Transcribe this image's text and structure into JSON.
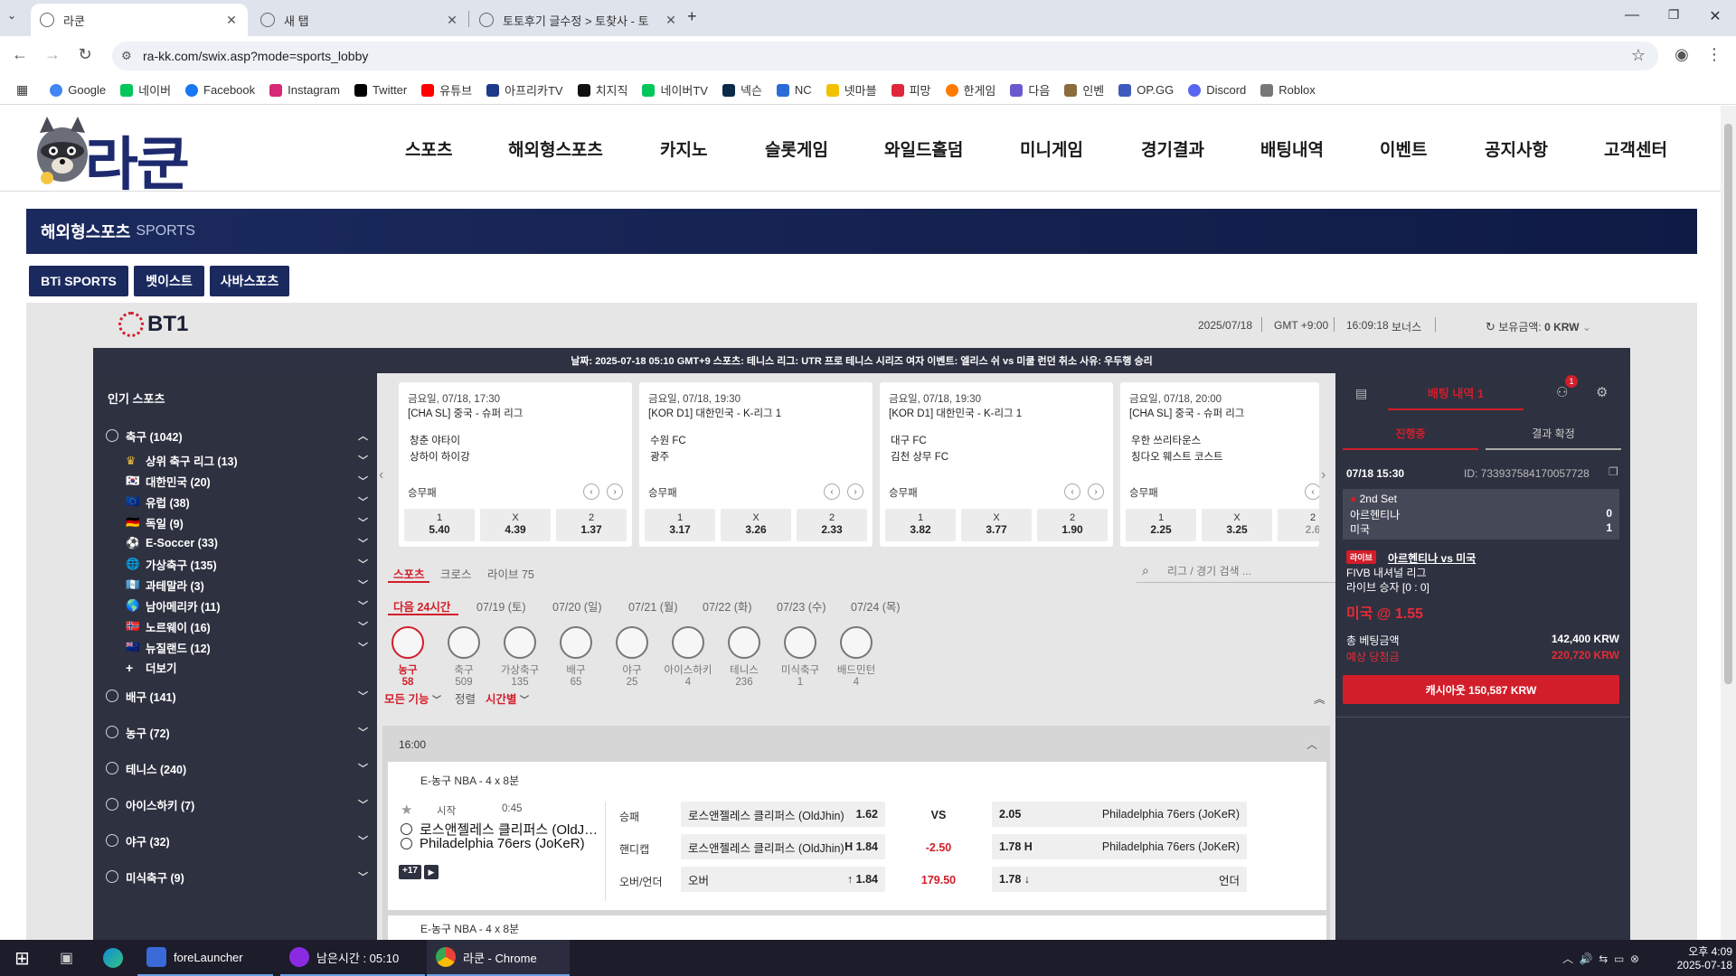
{
  "browser": {
    "tabs": [
      {
        "title": "라쿤",
        "active": true
      },
      {
        "title": "새 탭",
        "active": false
      },
      {
        "title": "토토후기 글수정 > 토찾사 - 토",
        "active": false
      }
    ],
    "url": "ra-kk.com/swix.asp?mode=sports_lobby",
    "bookmarks": [
      "Google",
      "네이버",
      "Facebook",
      "Instagram",
      "Twitter",
      "유튜브",
      "아프리카TV",
      "치지직",
      "네이버TV",
      "넥슨",
      "NC",
      "넷마블",
      "피망",
      "한게임",
      "다음",
      "인벤",
      "OP.GG",
      "Discord",
      "Roblox"
    ]
  },
  "site": {
    "logo_text": "라쿤",
    "nav": [
      "스포츠",
      "해외형스포츠",
      "카지노",
      "슬롯게임",
      "와일드홀덤",
      "미니게임",
      "경기결과",
      "배팅내역",
      "이벤트",
      "공지사항",
      "고객센터"
    ],
    "banner_title": "해외형스포츠",
    "banner_sub": "SPORTS",
    "providers": [
      "BTi SPORTS",
      "벳이스트",
      "사바스포츠"
    ]
  },
  "bti": {
    "logo": "BT1",
    "date": "2025/07/18",
    "gmt": "GMT +9:00",
    "time": "16:09:18",
    "bonus": "보너스",
    "balance_label": "보유금액:",
    "balance_value": "0 KRW",
    "ticker": "날짜: 2025-07-18 05:10 GMT+9 스포츠: 테니스 리그: UTR 프로 테니스 시리즈 여자 이벤트: 엘리스 쉬 vs 미쿨 런던 취소 사유: 우두행 승리"
  },
  "sidebar": {
    "title": "인기 스포츠",
    "soccer": "축구 (1042)",
    "soccer_sub": [
      "상위 축구 리그 (13)",
      "대한민국 (20)",
      "유럽 (38)",
      "독일 (9)",
      "E-Soccer (33)",
      "가상축구 (135)",
      "과테말라 (3)",
      "남아메리카 (11)",
      "노르웨이 (16)",
      "뉴질랜드 (12)"
    ],
    "more": "더보기",
    "sports": [
      "배구 (141)",
      "농구 (72)",
      "테니스 (240)",
      "아이스하키 (7)",
      "야구 (32)",
      "미식축구 (9)"
    ]
  },
  "cards": [
    {
      "date": "금요일, 07/18, 17:30",
      "league": "[CHA SL] 중국 - 슈퍼 리그",
      "home": "창춘 야타이",
      "away": "상하이 하이강",
      "market": "승무패",
      "odds": [
        {
          "l": "1",
          "v": "5.40"
        },
        {
          "l": "X",
          "v": "4.39"
        },
        {
          "l": "2",
          "v": "1.37"
        }
      ]
    },
    {
      "date": "금요일, 07/18, 19:30",
      "league": "[KOR D1] 대한민국 - K-리그 1",
      "home": "수원 FC",
      "away": "광주",
      "market": "승무패",
      "odds": [
        {
          "l": "1",
          "v": "3.17"
        },
        {
          "l": "X",
          "v": "3.26"
        },
        {
          "l": "2",
          "v": "2.33"
        }
      ]
    },
    {
      "date": "금요일, 07/18, 19:30",
      "league": "[KOR D1] 대한민국 - K-리그 1",
      "home": "대구 FC",
      "away": "김천 상무 FC",
      "market": "승무패",
      "odds": [
        {
          "l": "1",
          "v": "3.82"
        },
        {
          "l": "X",
          "v": "3.77"
        },
        {
          "l": "2",
          "v": "1.90"
        }
      ]
    },
    {
      "date": "금요일, 07/18, 20:00",
      "league": "[CHA SL] 중국 - 슈퍼 리그",
      "home": "우한 쓰리타운스",
      "away": "칭다오 웨스트 코스트",
      "market": "승무패",
      "odds": [
        {
          "l": "1",
          "v": "2.25"
        },
        {
          "l": "X",
          "v": "3.25"
        },
        {
          "l": "2",
          "v": "2.6"
        }
      ]
    }
  ],
  "center": {
    "tabs": [
      "스포츠",
      "크로스",
      "라이브 75"
    ],
    "search_placeholder": "리그 / 경기 검색 ...",
    "dates": [
      "다음 24시간",
      "07/19 (토)",
      "07/20 (일)",
      "07/21 (월)",
      "07/22 (화)",
      "07/23 (수)",
      "07/24 (목)"
    ],
    "sports": [
      {
        "name": "농구",
        "count": "58"
      },
      {
        "name": "축구",
        "count": "509"
      },
      {
        "name": "가상축구",
        "count": "135"
      },
      {
        "name": "배구",
        "count": "65"
      },
      {
        "name": "야구",
        "count": "25"
      },
      {
        "name": "아이스하키",
        "count": "4"
      },
      {
        "name": "테니스",
        "count": "236"
      },
      {
        "name": "미식축구",
        "count": "1"
      },
      {
        "name": "배드민턴",
        "count": "4"
      }
    ],
    "all_features": "모든 기능",
    "sort_label": "정렬",
    "sort_value": "시간별"
  },
  "event": {
    "time": "16:00",
    "league": "E-농구 NBA - 4 x 8분",
    "start_label": "시작",
    "start_time": "0:45",
    "home": "로스앤젤레스 클리퍼스 (OldJ…",
    "away": "Philadelphia 76ers (JoKeR)",
    "more": "+17",
    "markets": [
      {
        "label": "승패",
        "left": "로스앤젤레스 클리퍼스 (OldJhin)",
        "lv": "1.62",
        "mid": "VS",
        "rv": "2.05",
        "right": "Philadelphia 76ers (JoKeR)"
      },
      {
        "label": "핸디캡",
        "left": "로스앤젤레스 클리퍼스 (OldJhin)",
        "lv": "H 1.84",
        "mid": "-2.50",
        "rv": "1.78 H",
        "right": "Philadelphia 76ers (JoKeR)"
      },
      {
        "label": "오버/언더",
        "left": "오버",
        "lv": "↑ 1.84",
        "mid": "179.50",
        "rv": "1.78 ↓",
        "right": "언더"
      }
    ],
    "next_league": "E-농구 NBA - 4 x 8분"
  },
  "betslip": {
    "title": "배팅 내역 1",
    "badge": "1",
    "tabs": [
      "진행중",
      "결과 확정"
    ],
    "date": "07/18 15:30",
    "id": "ID: 733937584170057728",
    "set": "2nd Set",
    "team1": "아르헨티나",
    "score1": "0",
    "team2": "미국",
    "score2": "1",
    "live_badge": "라이브",
    "match": "아르헨티나 vs 미국",
    "league": "FIVB 내셔널 리그",
    "market": "라이브 승자 [0 : 0]",
    "pick": "미국 @ 1.55",
    "stake_label": "총 베팅금액",
    "stake": "142,400 KRW",
    "win_label": "예상 당첨금",
    "win": "220,720 KRW",
    "cashout": "캐시아웃 150,587 KRW"
  },
  "taskbar": {
    "items": [
      "foreLauncher",
      "남은시간 : 05:10",
      "라쿤 - Chrome"
    ],
    "clock_time": "오후 4:09",
    "clock_date": "2025-07-18"
  },
  "colors": {
    "accent": "#d21e2a",
    "navy": "#1b2a5e",
    "panel": "#2e3140"
  }
}
